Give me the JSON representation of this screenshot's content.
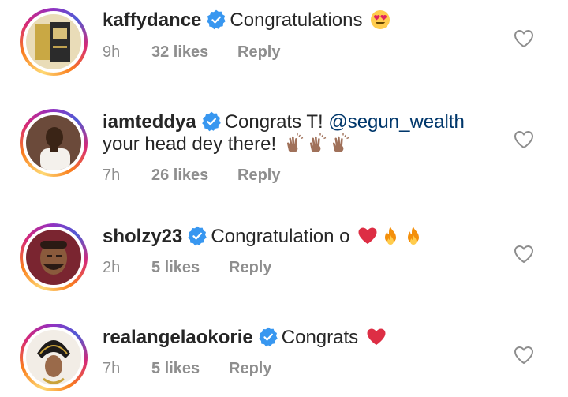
{
  "comments": [
    {
      "username": "kaffydance",
      "text": "Congratulations",
      "emojis": [
        "heart-eyes-face"
      ],
      "time": "9h",
      "likes": "32 likes",
      "reply": "Reply"
    },
    {
      "username": "iamteddya",
      "text_before": "Congrats T!",
      "mention": "@segun_wealth",
      "text_line2": "your head dey there!",
      "emojis": [
        "clapping-hands",
        "clapping-hands",
        "clapping-hands"
      ],
      "time": "7h",
      "likes": "26 likes",
      "reply": "Reply"
    },
    {
      "username": "sholzy23",
      "text": "Congratulation o",
      "emojis": [
        "red-heart",
        "fire",
        "fire"
      ],
      "time": "2h",
      "likes": "5 likes",
      "reply": "Reply"
    },
    {
      "username": "realangelaokorie",
      "text": "Congrats",
      "emojis": [
        "red-heart"
      ],
      "time": "7h",
      "likes": "5 likes",
      "reply": "Reply"
    }
  ],
  "colors": {
    "verified_blue": "#3897f0",
    "mention_blue": "#00376b",
    "meta_gray": "#8e8e8e",
    "text": "#262626"
  }
}
